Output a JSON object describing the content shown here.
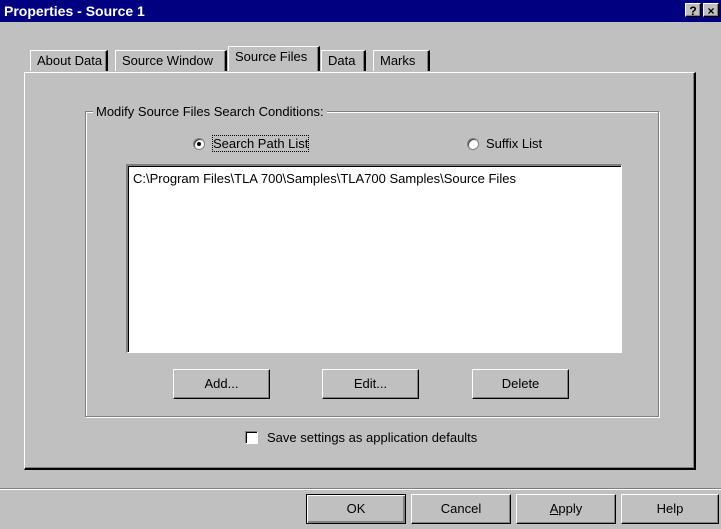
{
  "window": {
    "title": "Properties - Source 1",
    "help_label": "?",
    "close_label": "×"
  },
  "tabs": [
    {
      "label": "About Data",
      "active": false
    },
    {
      "label": "Source Window",
      "active": false
    },
    {
      "label": "Source Files",
      "active": true
    },
    {
      "label": "Data",
      "active": false
    },
    {
      "label": "Marks",
      "active": false
    }
  ],
  "group": {
    "title": "Modify Source Files Search Conditions:",
    "radio_options": [
      {
        "label": "Search Path List",
        "selected": true
      },
      {
        "label": "Suffix List",
        "selected": false
      }
    ],
    "list_items": [
      "C:\\Program Files\\TLA 700\\Samples\\TLA700 Samples\\Source Files"
    ],
    "buttons": {
      "add": "Add...",
      "edit": "Edit...",
      "delete": "Delete"
    }
  },
  "save_defaults": {
    "label": "Save settings as application defaults",
    "checked": false
  },
  "footer": {
    "ok": "OK",
    "cancel": "Cancel",
    "apply_accel": "A",
    "apply_rest": "pply",
    "help": "Help"
  },
  "colors": {
    "titlebar": "#000080",
    "face": "#c0c0c0",
    "window_bg": "#ffffff"
  }
}
